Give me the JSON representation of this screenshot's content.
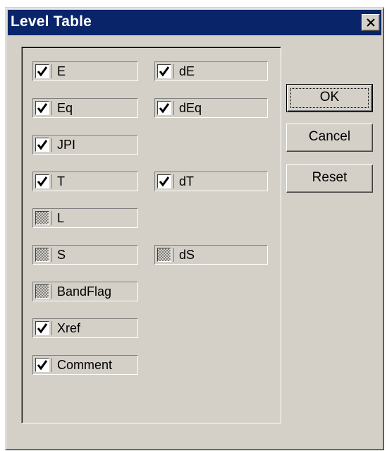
{
  "window": {
    "title": "Level Table"
  },
  "checkboxes": [
    {
      "label": "E",
      "state": "checked"
    },
    {
      "label": "dE",
      "state": "checked"
    },
    {
      "label": "Eq",
      "state": "checked"
    },
    {
      "label": "dEq",
      "state": "checked"
    },
    {
      "label": "JPI",
      "state": "checked"
    },
    {
      "label": "T",
      "state": "checked"
    },
    {
      "label": "dT",
      "state": "checked"
    },
    {
      "label": "L",
      "state": "indeterminate"
    },
    {
      "label": "S",
      "state": "indeterminate"
    },
    {
      "label": "dS",
      "state": "indeterminate"
    },
    {
      "label": "BandFlag",
      "state": "indeterminate"
    },
    {
      "label": "Xref",
      "state": "checked"
    },
    {
      "label": "Comment",
      "state": "checked"
    }
  ],
  "buttons": {
    "ok": "OK",
    "cancel": "Cancel",
    "reset": "Reset"
  },
  "icons": {
    "close": "close-icon",
    "check": "check-icon"
  },
  "colors": {
    "titlebar": "#0a246a",
    "face": "#d4d0c8"
  }
}
